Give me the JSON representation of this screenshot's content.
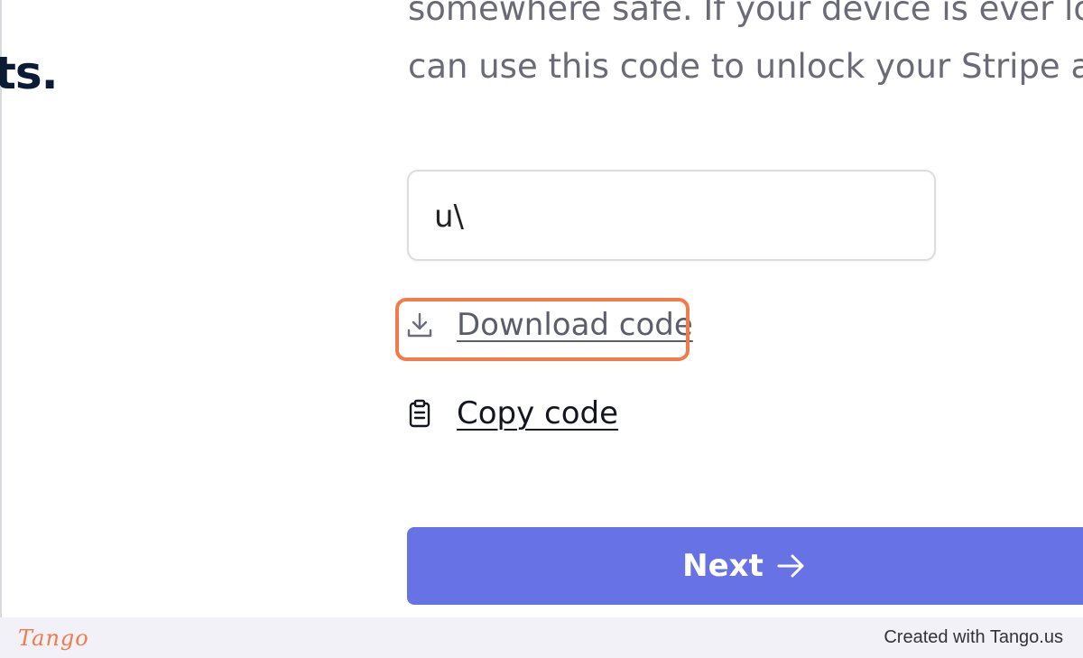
{
  "left_panel": {
    "heading_fragment": "ts."
  },
  "instructions": {
    "line1": "somewhere safe. If your device is ever lost,",
    "line2": "can use this code to unlock your Stripe account"
  },
  "code_field": {
    "value": "u\\"
  },
  "actions": {
    "download_label": "Download code",
    "download_icon": "download-icon",
    "copy_label": "Copy code",
    "copy_icon": "clipboard-icon"
  },
  "next_button": {
    "label": "Next",
    "icon": "arrow-right-icon"
  },
  "footer": {
    "brand": "Tango",
    "credit": "Created with Tango.us"
  },
  "colors": {
    "accent": "#6772e5",
    "highlight": "#f27a4b",
    "footer_bg": "#f2f1f7"
  }
}
